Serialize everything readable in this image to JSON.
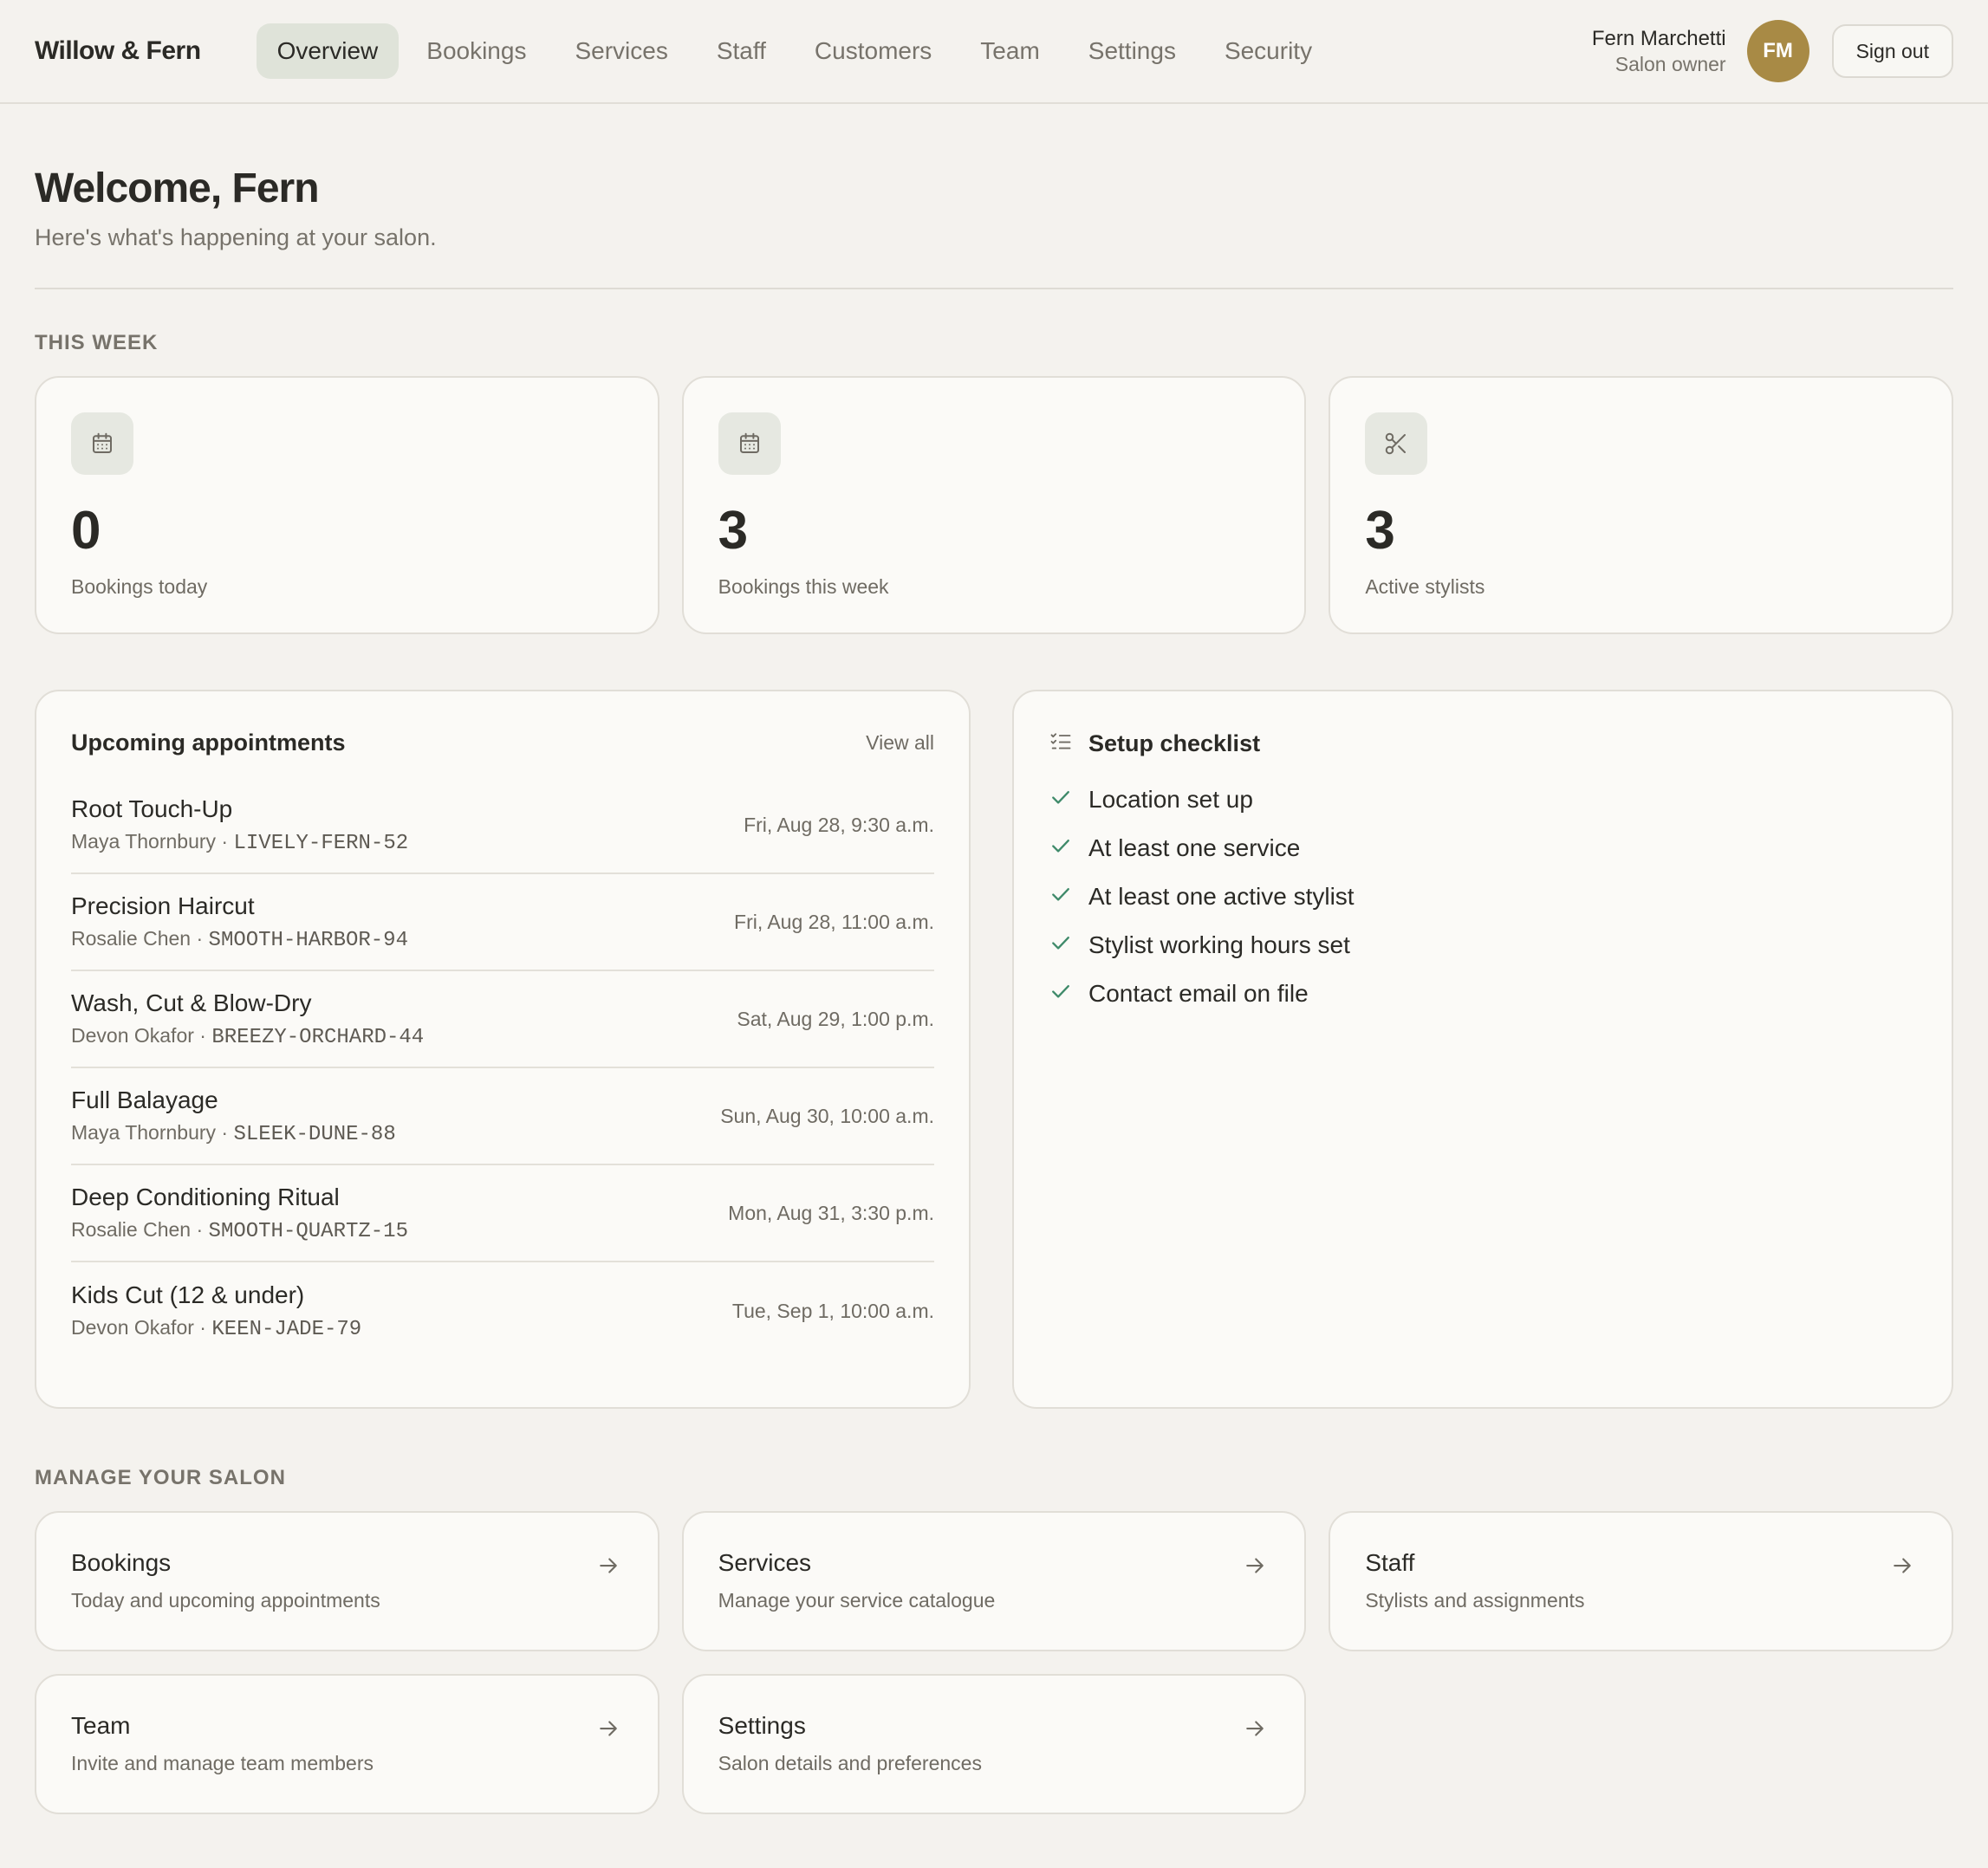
{
  "header": {
    "brand": "Willow & Fern",
    "nav": [
      {
        "label": "Overview",
        "active": true
      },
      {
        "label": "Bookings"
      },
      {
        "label": "Services"
      },
      {
        "label": "Staff"
      },
      {
        "label": "Customers"
      },
      {
        "label": "Team"
      },
      {
        "label": "Settings"
      },
      {
        "label": "Security"
      }
    ],
    "user": {
      "name": "Fern Marchetti",
      "role": "Salon owner",
      "initials": "FM"
    },
    "signout": "Sign out"
  },
  "welcome": {
    "title": "Welcome, Fern",
    "subtitle": "Here's what's happening at your salon."
  },
  "this_week": {
    "label": "THIS WEEK",
    "stats": [
      {
        "value": "0",
        "label": "Bookings today",
        "icon": "calendar-icon"
      },
      {
        "value": "3",
        "label": "Bookings this week",
        "icon": "calendar-icon"
      },
      {
        "value": "3",
        "label": "Active stylists",
        "icon": "scissors-icon"
      }
    ]
  },
  "appointments": {
    "title": "Upcoming appointments",
    "view_all": "View all",
    "items": [
      {
        "service": "Root Touch-Up",
        "customer": "Maya Thornbury",
        "code": "LIVELY-FERN-52",
        "time": "Fri, Aug 28, 9:30 a.m."
      },
      {
        "service": "Precision Haircut",
        "customer": "Rosalie Chen",
        "code": "SMOOTH-HARBOR-94",
        "time": "Fri, Aug 28, 11:00 a.m."
      },
      {
        "service": "Wash, Cut & Blow-Dry",
        "customer": "Devon Okafor",
        "code": "BREEZY-ORCHARD-44",
        "time": "Sat, Aug 29, 1:00 p.m."
      },
      {
        "service": "Full Balayage",
        "customer": "Maya Thornbury",
        "code": "SLEEK-DUNE-88",
        "time": "Sun, Aug 30, 10:00 a.m."
      },
      {
        "service": "Deep Conditioning Ritual",
        "customer": "Rosalie Chen",
        "code": "SMOOTH-QUARTZ-15",
        "time": "Mon, Aug 31, 3:30 p.m."
      },
      {
        "service": "Kids Cut (12 & under)",
        "customer": "Devon Okafor",
        "code": "KEEN-JADE-79",
        "time": "Tue, Sep 1, 10:00 a.m."
      }
    ],
    "separator": " · "
  },
  "checklist": {
    "title": "Setup checklist",
    "items": [
      "Location set up",
      "At least one service",
      "At least one active stylist",
      "Stylist working hours set",
      "Contact email on file"
    ]
  },
  "manage": {
    "label": "MANAGE YOUR SALON",
    "cards": [
      {
        "title": "Bookings",
        "desc": "Today and upcoming appointments"
      },
      {
        "title": "Services",
        "desc": "Manage your service catalogue"
      },
      {
        "title": "Staff",
        "desc": "Stylists and assignments"
      },
      {
        "title": "Team",
        "desc": "Invite and manage team members"
      },
      {
        "title": "Settings",
        "desc": "Salon details and preferences"
      }
    ]
  },
  "colors": {
    "accent": "#a88a45",
    "check": "#3f8a6a",
    "nav_active_bg": "#dfe3d9"
  }
}
